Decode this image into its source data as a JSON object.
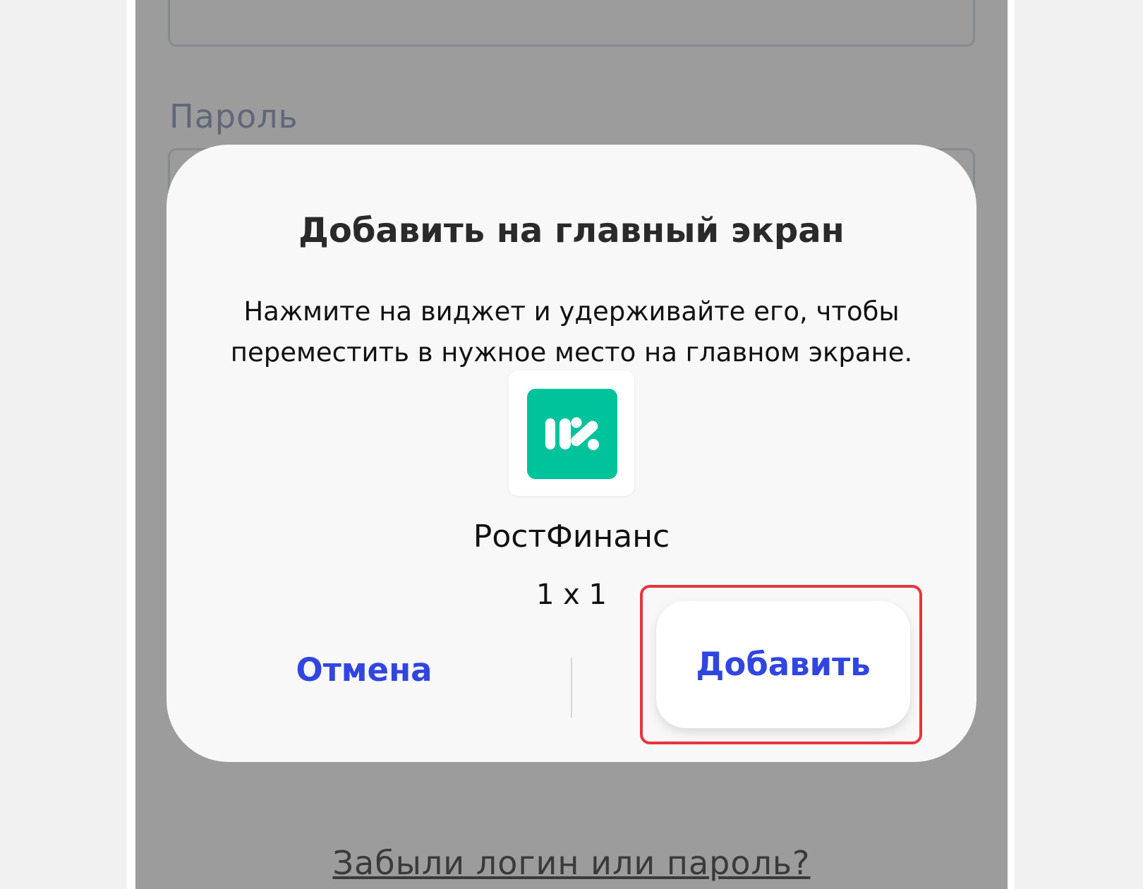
{
  "background_form": {
    "password_label": "Пароль",
    "forgot_link": "Забыли логин или пароль?"
  },
  "dialog": {
    "title": "Добавить на главный экран",
    "description": "Нажмите на виджет и удерживайте его, чтобы переместить в нужное место на главном экране.",
    "widget": {
      "app_name": "РостФинанс",
      "size": "1 x 1",
      "icon": "rostfinans-logo-icon",
      "icon_color": "#00c39b"
    },
    "cancel_label": "Отмена",
    "add_label": "Добавить",
    "accent_color": "#3145e0"
  },
  "highlight_color": "#e8343f"
}
